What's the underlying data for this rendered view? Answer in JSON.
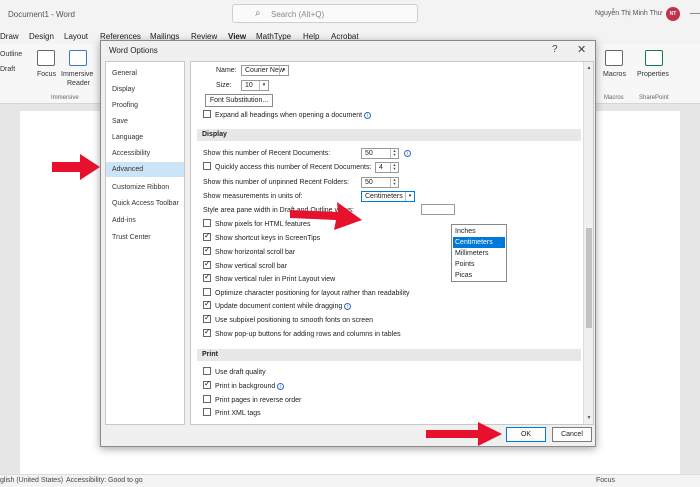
{
  "app": {
    "doc_title": "Document1  -  Word",
    "search_placeholder": "Search (Alt+Q)",
    "user_name": "Nguyễn Thị Minh Thư",
    "user_initials": "NT"
  },
  "ribbon_tabs": [
    "Draw",
    "Design",
    "Layout",
    "References",
    "Mailings",
    "Review",
    "View",
    "MathType",
    "Help",
    "Acrobat"
  ],
  "ribbon": {
    "outline": "Outline",
    "draft": "Draft",
    "focus": "Focus",
    "immersive_reader_1": "Immersive",
    "immersive_reader_2": "Reader",
    "group_immersive": "Immersive",
    "macros": "Macros",
    "group_macros": "Macros",
    "properties": "Properties",
    "group_sharepoint": "SharePoint"
  },
  "status": {
    "language": "glish (United States)",
    "accessibility": "Accessibility: Good to go",
    "focus": "Focus"
  },
  "dialog": {
    "title": "Word Options",
    "help": "?",
    "close": "✕",
    "nav_items": [
      "General",
      "Display",
      "Proofing",
      "Save",
      "Language",
      "Accessibility",
      "Advanced",
      "Customize Ribbon",
      "Quick Access Toolbar",
      "Add-ins",
      "Trust Center"
    ],
    "selected_nav": "Advanced",
    "font_name_label": "Name:",
    "font_name_value": "Courier New",
    "font_size_label": "Size:",
    "font_size_value": "10",
    "font_substitution": "Font Substitution...",
    "expand_headings": "Expand all headings when opening a document",
    "display_section": "Display",
    "recent_docs_label": "Show this number of Recent Documents:",
    "recent_docs_value": "50",
    "quick_access_label": "Quickly access this number of Recent Documents:",
    "quick_access_value": "4",
    "unpinned_folders_label": "Show this number of unpinned Recent Folders:",
    "unpinned_folders_value": "50",
    "measurement_label": "Show measurements in units of:",
    "measurement_value": "Centimeters",
    "style_area_label": "Style area pane width in Draft and Outline views:",
    "display_options": [
      {
        "label": "Show pixels for HTML features",
        "checked": false
      },
      {
        "label": "Show shortcut keys in ScreenTips",
        "checked": true
      },
      {
        "label": "Show horizontal scroll bar",
        "checked": true
      },
      {
        "label": "Show vertical scroll bar",
        "checked": true
      },
      {
        "label": "Show vertical ruler in Print Layout view",
        "checked": true
      },
      {
        "label": "Optimize character positioning for layout rather than readability",
        "checked": false
      },
      {
        "label": "Update document content while dragging",
        "checked": true
      },
      {
        "label": "Use subpixel positioning to smooth fonts on screen",
        "checked": true
      },
      {
        "label": "Show pop-up buttons for adding rows and columns in tables",
        "checked": true
      }
    ],
    "units_options": [
      "Inches",
      "Centimeters",
      "Millimeters",
      "Points",
      "Picas"
    ],
    "units_selected": "Centimeters",
    "print_section": "Print",
    "print_options": [
      {
        "label": "Use draft quality",
        "checked": false
      },
      {
        "label": "Print in background",
        "checked": true
      },
      {
        "label": "Print pages in reverse order",
        "checked": false
      },
      {
        "label": "Print XML tags",
        "checked": false
      }
    ],
    "ok": "OK",
    "cancel": "Cancel"
  },
  "colors": {
    "arrow_red": "#e8112d",
    "selection_blue": "#0078d7",
    "nav_selected": "#cce4f7",
    "avatar": "#c4314b"
  }
}
